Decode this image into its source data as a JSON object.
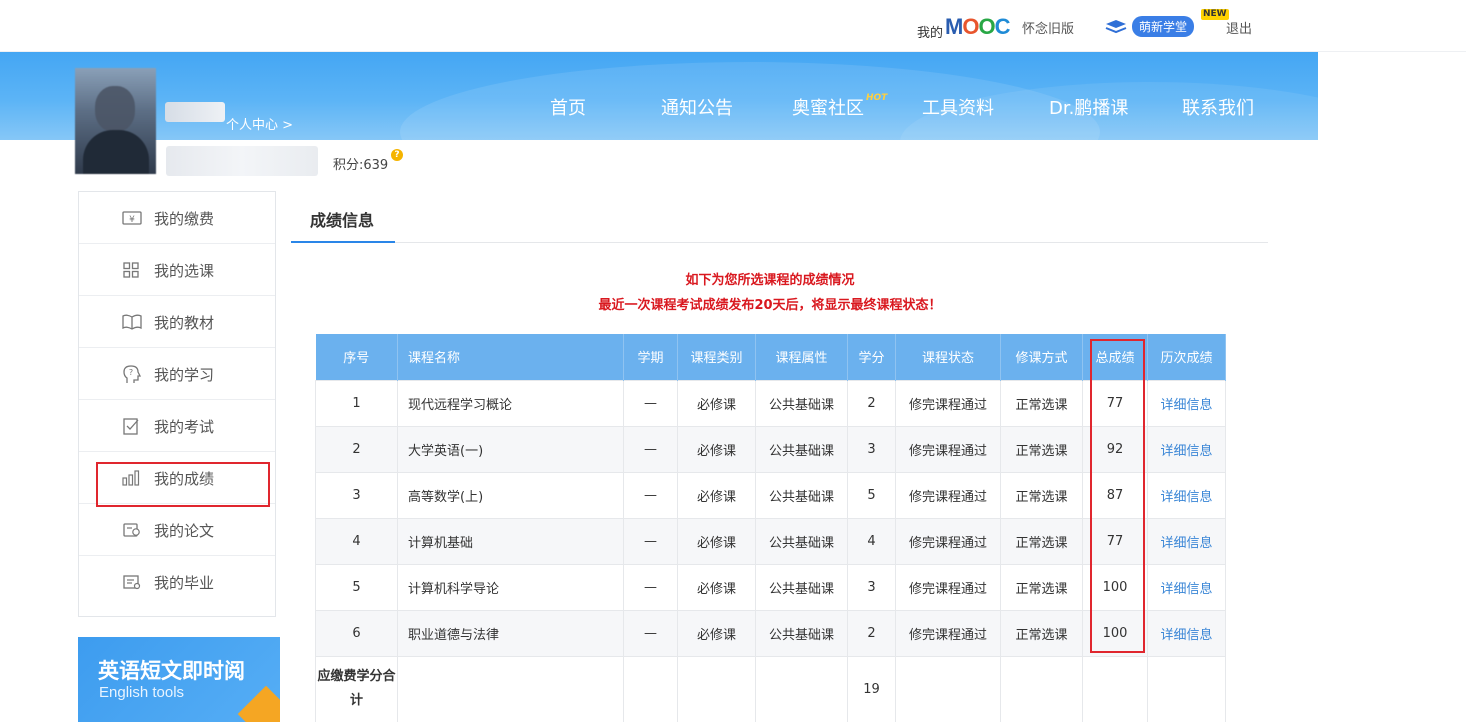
{
  "topbar": {
    "my_prefix": "我的",
    "mooc_logo": "MOOC",
    "old_version": "怀念旧版",
    "mengxin": "萌新学堂",
    "new_badge": "NEW",
    "logout": "退出"
  },
  "nav": {
    "items": [
      {
        "label": "首页"
      },
      {
        "label": "通知公告"
      },
      {
        "label": "奥蜜社区",
        "badge": "HOT"
      },
      {
        "label": "工具资料"
      },
      {
        "label": "Dr.鹏播课"
      },
      {
        "label": "联系我们"
      }
    ]
  },
  "profile": {
    "personal_center": "个人中心 >",
    "points": "积分:639",
    "coin_glyph": "?"
  },
  "sidebar": {
    "items": [
      {
        "label": "我的缴费",
        "icon": "yuan-card-icon"
      },
      {
        "label": "我的选课",
        "icon": "grid-icon"
      },
      {
        "label": "我的教材",
        "icon": "book-icon"
      },
      {
        "label": "我的学习",
        "icon": "head-question-icon"
      },
      {
        "label": "我的考试",
        "icon": "exam-paper-icon"
      },
      {
        "label": "我的成绩",
        "icon": "bar-chart-icon",
        "active": true
      },
      {
        "label": "我的论文",
        "icon": "thesis-icon"
      },
      {
        "label": "我的毕业",
        "icon": "graduation-certificate-icon"
      }
    ],
    "promo_title": "英语短文即时阅",
    "promo_subtitle": "English tools"
  },
  "main": {
    "tab": "成绩信息",
    "notice_line1": "如下为您所选课程的成绩情况",
    "notice_line2": "最近一次课程考试成绩发布20天后，将显示最终课程状态！",
    "columns": [
      "序号",
      "课程名称",
      "学期",
      "课程类别",
      "课程属性",
      "学分",
      "课程状态",
      "修课方式",
      "总成绩",
      "历次成绩"
    ],
    "rows": [
      {
        "no": "1",
        "name": "现代远程学习概论",
        "term": "—",
        "category": "必修课",
        "attribute": "公共基础课",
        "credit": "2",
        "status": "修完课程通过",
        "mode": "正常选课",
        "score": "77",
        "history": "详细信息"
      },
      {
        "no": "2",
        "name": "大学英语(一)",
        "term": "—",
        "category": "必修课",
        "attribute": "公共基础课",
        "credit": "3",
        "status": "修完课程通过",
        "mode": "正常选课",
        "score": "92",
        "history": "详细信息"
      },
      {
        "no": "3",
        "name": "高等数学(上)",
        "term": "—",
        "category": "必修课",
        "attribute": "公共基础课",
        "credit": "5",
        "status": "修完课程通过",
        "mode": "正常选课",
        "score": "87",
        "history": "详细信息"
      },
      {
        "no": "4",
        "name": "计算机基础",
        "term": "—",
        "category": "必修课",
        "attribute": "公共基础课",
        "credit": "4",
        "status": "修完课程通过",
        "mode": "正常选课",
        "score": "77",
        "history": "详细信息"
      },
      {
        "no": "5",
        "name": "计算机科学导论",
        "term": "—",
        "category": "必修课",
        "attribute": "公共基础课",
        "credit": "3",
        "status": "修完课程通过",
        "mode": "正常选课",
        "score": "100",
        "history": "详细信息"
      },
      {
        "no": "6",
        "name": "职业道德与法律",
        "term": "—",
        "category": "必修课",
        "attribute": "公共基础课",
        "credit": "2",
        "status": "修完课程通过",
        "mode": "正常选课",
        "score": "100",
        "history": "详细信息"
      }
    ],
    "total_label": "应缴费学分合计",
    "total_credit": "19"
  },
  "colors": {
    "header_blue": "#44a6f3",
    "table_header": "#6bb1ee",
    "highlight_red": "#e0262e",
    "link_blue": "#3a86d6",
    "notice_red": "#d9181f"
  }
}
